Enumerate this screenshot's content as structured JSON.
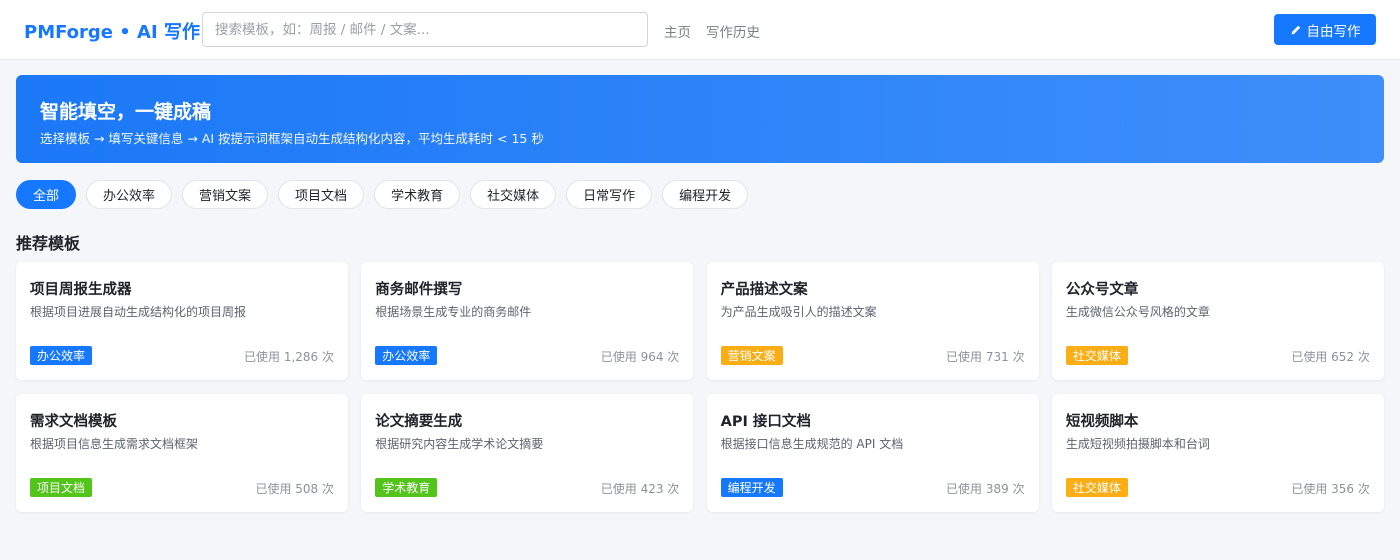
{
  "header": {
    "logo": "PMForge • AI 写作",
    "search_placeholder": "搜索模板，如：周报 / 邮件 / 文案...",
    "nav": [
      "主页",
      "写作历史"
    ],
    "write_button": "自由写作",
    "write_icon": "pen-icon",
    "accent_color": "#1677ff"
  },
  "banner": {
    "title": "智能填空，一键成稿",
    "subtitle": "选择模板 → 填写关键信息 → AI 按提示词框架自动生成结构化内容，平均生成耗时 < 15 秒"
  },
  "filters": {
    "selected": "全部",
    "items": [
      "全部",
      "办公效率",
      "营销文案",
      "项目文档",
      "学术教育",
      "社交媒体",
      "日常写作",
      "编程开发"
    ]
  },
  "section_title": "推荐模板",
  "tag_colors": {
    "办公效率": "#1677ff",
    "营销文案": "#faad14",
    "社交媒体": "#faad14",
    "项目文档": "#52c41a",
    "学术教育": "#52c41a",
    "编程开发": "#1677ff"
  },
  "cards": [
    {
      "title": "项目周报生成器",
      "desc": "根据项目进展自动生成结构化的项目周报",
      "tag": "办公效率",
      "usage": "已使用 1,286 次"
    },
    {
      "title": "商务邮件撰写",
      "desc": "根据场景生成专业的商务邮件",
      "tag": "办公效率",
      "usage": "已使用 964 次"
    },
    {
      "title": "产品描述文案",
      "desc": "为产品生成吸引人的描述文案",
      "tag": "营销文案",
      "usage": "已使用 731 次"
    },
    {
      "title": "公众号文章",
      "desc": "生成微信公众号风格的文章",
      "tag": "社交媒体",
      "usage": "已使用 652 次"
    },
    {
      "title": "需求文档模板",
      "desc": "根据项目信息生成需求文档框架",
      "tag": "项目文档",
      "usage": "已使用 508 次"
    },
    {
      "title": "论文摘要生成",
      "desc": "根据研究内容生成学术论文摘要",
      "tag": "学术教育",
      "usage": "已使用 423 次"
    },
    {
      "title": "API 接口文档",
      "desc": "根据接口信息生成规范的 API 文档",
      "tag": "编程开发",
      "usage": "已使用 389 次"
    },
    {
      "title": "短视频脚本",
      "desc": "生成短视频拍摄脚本和台词",
      "tag": "社交媒体",
      "usage": "已使用 356 次"
    }
  ]
}
